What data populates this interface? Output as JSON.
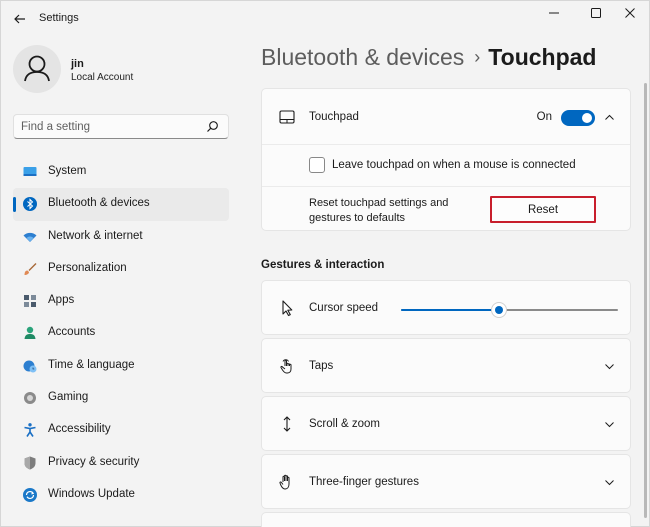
{
  "window": {
    "title": "Settings"
  },
  "user": {
    "name": "jin",
    "account_type": "Local Account"
  },
  "search": {
    "placeholder": "Find a setting"
  },
  "sidebar": {
    "items": [
      {
        "label": "System",
        "icon": "system-icon",
        "color": "#1a8ad4"
      },
      {
        "label": "Bluetooth & devices",
        "icon": "bluetooth-icon",
        "color": "#0067c0",
        "selected": true
      },
      {
        "label": "Network & internet",
        "icon": "wifi-icon",
        "color": "#2d7fd0"
      },
      {
        "label": "Personalization",
        "icon": "brush-icon",
        "color": "#d8794b"
      },
      {
        "label": "Apps",
        "icon": "apps-icon",
        "color": "#4a5a6c"
      },
      {
        "label": "Accounts",
        "icon": "accounts-icon",
        "color": "#2aa37a"
      },
      {
        "label": "Time & language",
        "icon": "clock-globe-icon",
        "color": "#2d7fd0"
      },
      {
        "label": "Gaming",
        "icon": "gamepad-icon",
        "color": "#7a7a7a"
      },
      {
        "label": "Accessibility",
        "icon": "accessibility-icon",
        "color": "#1a6fc4"
      },
      {
        "label": "Privacy & security",
        "icon": "shield-icon",
        "color": "#6b6b6b"
      },
      {
        "label": "Windows Update",
        "icon": "update-icon",
        "color": "#1a78c8"
      }
    ]
  },
  "breadcrumb": {
    "parent": "Bluetooth & devices",
    "separator": "›",
    "current": "Touchpad"
  },
  "touchpad_card": {
    "label": "Touchpad",
    "toggle_state": "On",
    "toggle_on": true,
    "leave_on_label": "Leave touchpad on when a mouse is connected",
    "leave_on_checked": false,
    "reset_text": "Reset touchpad settings and gestures to defaults",
    "reset_button": "Reset"
  },
  "gestures": {
    "section_title": "Gestures & interaction",
    "cursor_speed_label": "Cursor speed",
    "cursor_speed_fraction": 0.45,
    "rows": [
      {
        "label": "Taps",
        "icon": "tap-icon"
      },
      {
        "label": "Scroll & zoom",
        "icon": "scroll-zoom-icon"
      },
      {
        "label": "Three-finger gestures",
        "icon": "hand-icon"
      }
    ]
  },
  "colors": {
    "accent": "#0067c0",
    "reset_outline": "#c81e2c"
  }
}
